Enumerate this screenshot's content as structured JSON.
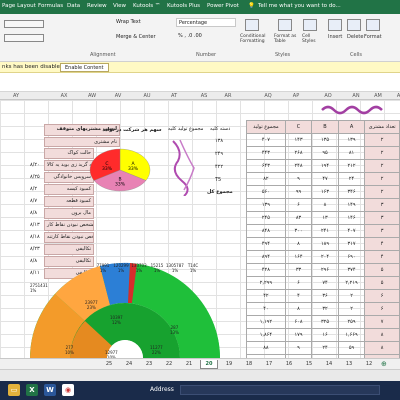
{
  "menu": {
    "tabs": [
      "Page Layout",
      "Formulas",
      "Data",
      "Review",
      "View",
      "Kutools ™",
      "Kutools Plus",
      "Power Pivot"
    ],
    "tell_me": "Tell me what you want to do..."
  },
  "ribbon": {
    "wrap_text": "Wrap Text",
    "merge_center": "Merge & Center",
    "number_format": "Percentage",
    "alignment_label": "Alignment",
    "number_label": "Number",
    "styles_label": "Styles",
    "cells_label": "Cells",
    "conditional_formatting": "Conditional Formatting",
    "format_as_table": "Format as Table",
    "cell_styles": "Cell Styles",
    "insert": "Insert",
    "delete": "Delete",
    "format": "Format"
  },
  "message_bar": {
    "text": "nks has been disabled",
    "button": "Enable Content"
  },
  "columns": [
    "AY",
    "AX",
    "AW",
    "AV",
    "AU",
    "AT",
    "AS",
    "AR",
    "AQ",
    "AP",
    "AO",
    "AN",
    "AM",
    "AL"
  ],
  "left_list": {
    "title": "لیست مشتریهای متوقف",
    "header": "نام مشتری",
    "rows": [
      {
        "name": "حالت کواک",
        "val": ""
      },
      {
        "name": "تعمیر کاتینه گرید زی بوید یه کالا",
        "val": "۸/۲۰"
      },
      {
        "name": "سرویس خانوادگی",
        "val": "۸/۲۵"
      },
      {
        "name": "کمبود کیسه",
        "val": "۸/۲"
      },
      {
        "name": "کمبود قطعه",
        "val": "۸/۷"
      },
      {
        "name": "مال برون",
        "val": "۸/۸"
      },
      {
        "name": "مشخص نبودن نقاط کار",
        "val": "۸/۱۳"
      },
      {
        "name": "مشخص نبودن نقاط کارتنه",
        "val": "۸/۱۸"
      },
      {
        "name": "تکالیفی",
        "val": "۸/۲۳"
      },
      {
        "name": "تکالیفی",
        "val": "۸/۸"
      },
      {
        "name": "تکالیفی",
        "val": "۸/۱۱"
      }
    ]
  },
  "pie_title": "سهم هر شرکت در تولید",
  "pie_data": {
    "type": "pie",
    "labels": [
      "A",
      "B",
      "C"
    ],
    "values": [
      33,
      33,
      33
    ],
    "label_texts": [
      "A\n33%",
      "B\n33%",
      "C\n33%"
    ],
    "colors": [
      "#ffff00",
      "#e882b4",
      "#ff2b2b"
    ]
  },
  "mid_table": {
    "header1": "مجموع تولید کلیه",
    "header2": "دسته کلیه",
    "values": [
      "۱۳۸",
      "۲۴۹",
      "۴۲۲",
      "T5"
    ],
    "footer": "مجموع کل"
  },
  "main_table": {
    "headers": [
      "مجموع تولید",
      "C",
      "B",
      "A",
      "تعداد مشتری"
    ],
    "rows": [
      [
        "۴۰۷",
        "۱۴۳",
        "۱۳۵",
        "۱۳۹",
        "۲"
      ],
      [
        "۴۴۳",
        "۲۶۸",
        "۹۵",
        "۸۱",
        "۲"
      ],
      [
        "۶۴۳",
        "۲۴۸",
        "۱۹۴",
        "۲۱۲",
        "۲"
      ],
      [
        "۸۲",
        "۹",
        "۴۷",
        "۲۴",
        "۲"
      ],
      [
        "۵۶۰",
        "۹۹",
        "۱۶۳",
        "۳۴۶",
        "۲"
      ],
      [
        "۱۳۹",
        "۶",
        "۸",
        "۱۴۹",
        "۳"
      ],
      [
        "۲۴۵",
        "۸۳",
        "۱۳",
        "۱۴۶",
        "۳"
      ],
      [
        "۸۴۸",
        "۳۰۰",
        "۲۴۱",
        "۴۰۷",
        "۳"
      ],
      [
        "۴۹۴",
        "۸",
        "۱۸۹",
        "۳۱۷",
        "۴"
      ],
      [
        "۸۹۴",
        "۱۶۴",
        "۲۰۴",
        "۶۹۰",
        "۴"
      ],
      [
        "۴۲۸",
        "۳۳",
        "۲۹۶",
        "۳۷۴",
        "۵"
      ],
      [
        "۲,۲۹۹",
        "۶",
        "۷۴",
        "۲,۲۱۹",
        "۵"
      ],
      [
        "۴۲",
        "۴",
        "۳۶",
        "۲",
        "۶"
      ],
      [
        "۴۰",
        "۸",
        "۳۲",
        "۲",
        "۶"
      ],
      [
        "۱,۱۹۲",
        "۶۰۸",
        "۳۲۵",
        "۲۵۹",
        "۷"
      ],
      [
        "۱,۸۶۴",
        "۱۷۹",
        "۱۶",
        "۱,۶۶۹",
        "۸"
      ],
      [
        "۸۸",
        "۹",
        "۲۴",
        "۵۹",
        "۸"
      ],
      [
        "۱,۱۶۹",
        "۶۰۵",
        "۳۲۲",
        "۳۴۲",
        "۹"
      ]
    ]
  },
  "sunburst": {
    "top_labels": [
      "77991\n1%",
      "120299\n1%",
      "133703\n1%",
      "15215\n1%",
      "13057875\n1%",
      "T14C\n1%"
    ],
    "left_label": "2751431\n1%",
    "seg_labels": [
      "23977\n23%",
      "10397\n12%",
      "277\n10%",
      "12977\n10%",
      "287\n13%",
      "11277\n22%"
    ]
  },
  "sheet_tabs": [
    "25",
    "24",
    "23",
    "22",
    "21",
    "20",
    "19",
    "18",
    "17",
    "16",
    "15",
    "14",
    "13",
    "12"
  ],
  "active_tab": "20",
  "status": {
    "address_label": "Address"
  },
  "colors": {
    "excel_green": "#217346",
    "pink": "#f2dcdb",
    "sun_green": "#1fbf3a",
    "sun_orange": "#f39b2a"
  }
}
